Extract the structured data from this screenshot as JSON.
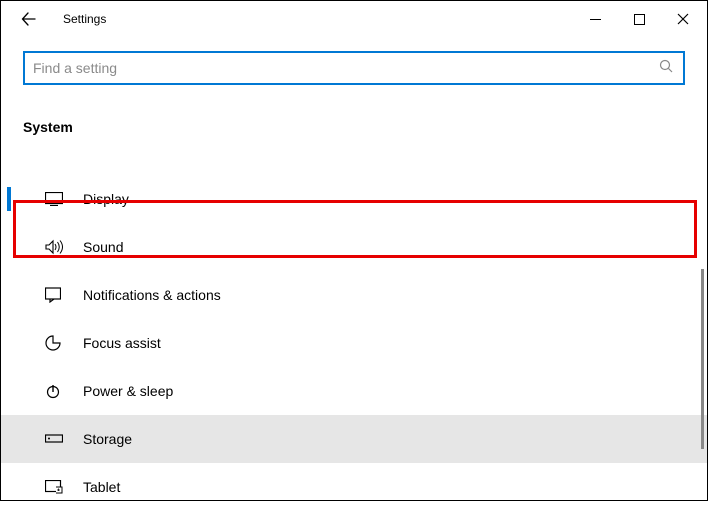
{
  "title": "Settings",
  "search": {
    "placeholder": "Find a setting"
  },
  "heading": "System",
  "items": [
    {
      "label": "Display",
      "icon": "display"
    },
    {
      "label": "Sound",
      "icon": "sound"
    },
    {
      "label": "Notifications & actions",
      "icon": "notifications"
    },
    {
      "label": "Focus assist",
      "icon": "focus"
    },
    {
      "label": "Power & sleep",
      "icon": "power"
    },
    {
      "label": "Storage",
      "icon": "storage"
    },
    {
      "label": "Tablet",
      "icon": "tablet"
    }
  ]
}
